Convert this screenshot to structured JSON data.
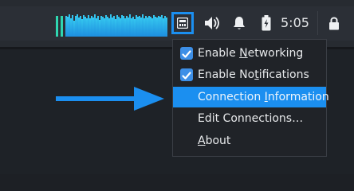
{
  "panel": {
    "clock": "5:05",
    "icons": {
      "network": "network-wired-icon",
      "volume": "volume-icon",
      "notifications": "bell-icon",
      "battery": "battery-charging-icon",
      "lock": "lock-icon"
    }
  },
  "graph_levels": [
    0.9,
    0.85,
    0.95,
    0.8,
    0.92,
    0.7,
    0.88,
    0.96,
    0.82,
    0.9,
    0.75,
    0.93,
    0.86,
    0.8,
    0.94,
    0.78,
    0.9,
    0.84,
    0.97,
    0.8,
    0.88,
    0.72,
    0.91,
    0.85,
    0.79,
    0.93,
    0.87,
    0.8,
    0.95,
    0.83,
    0.9,
    0.76,
    0.92,
    0.86,
    0.81,
    0.94,
    0.88,
    0.79,
    0.9,
    0.84,
    0.96,
    0.8,
    0.87,
    0.75,
    0.92,
    0.85,
    0.9,
    0.82,
    0.95,
    0.78,
    0.89,
    0.83,
    0.91,
    0.86,
    0.8,
    0.94,
    0.87,
    0.82,
    0.9,
    0.85,
    0.93,
    0.8,
    0.88,
    0.84
  ],
  "menu": {
    "items": [
      {
        "pre": "Enable ",
        "mn": "N",
        "post": "etworking",
        "checked": true
      },
      {
        "pre": "Enable No",
        "mn": "t",
        "post": "ifications",
        "checked": true
      },
      {
        "pre": "Connection ",
        "mn": "I",
        "post": "nformation",
        "checked": false
      },
      {
        "pre": "Edit Connections…",
        "mn": "",
        "post": "",
        "checked": false
      },
      {
        "pre": "",
        "mn": "A",
        "post": "bout",
        "checked": false
      }
    ]
  },
  "colors": {
    "accent": "#1b8ff0",
    "checkbox": "#3d8fe7",
    "graph": "#35c7ef",
    "panel": "#272b31",
    "menu_bg": "#202328",
    "text": "#e8eaec"
  }
}
